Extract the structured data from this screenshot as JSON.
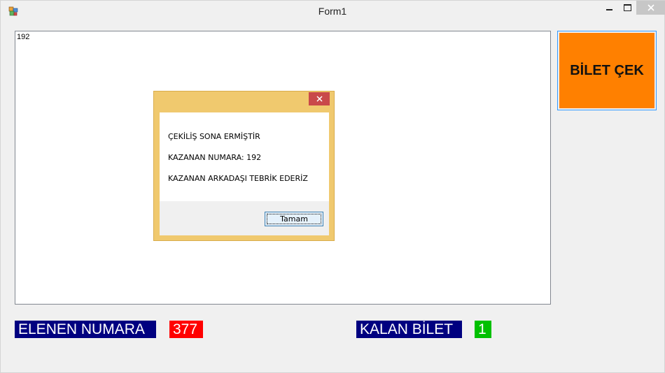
{
  "window": {
    "title": "Form1"
  },
  "main": {
    "textarea_value": "192",
    "draw_button_label": "BİLET ÇEK",
    "eliminated_label": "ELENEN NUMARA",
    "eliminated_value": "377",
    "remaining_label": "KALAN BİLET",
    "remaining_value": "1"
  },
  "dialog": {
    "lines": [
      "ÇEKİLİŞ SONA ERMİŞTİR",
      "KAZANAN NUMARA: 192",
      "KAZANAN ARKADAŞI TEBRİK EDERİZ"
    ],
    "ok_label": "Tamam"
  },
  "colors": {
    "draw_button": "#ff8000",
    "label_bg": "#000080",
    "eliminated_bg": "#ff0000",
    "remaining_bg": "#00c000",
    "dialog_frame": "#f0c96e",
    "dialog_close": "#c9494a"
  },
  "icons": {
    "app": "form-app-icon",
    "minimize": "minimize-icon",
    "maximize": "maximize-icon",
    "close": "close-icon"
  }
}
